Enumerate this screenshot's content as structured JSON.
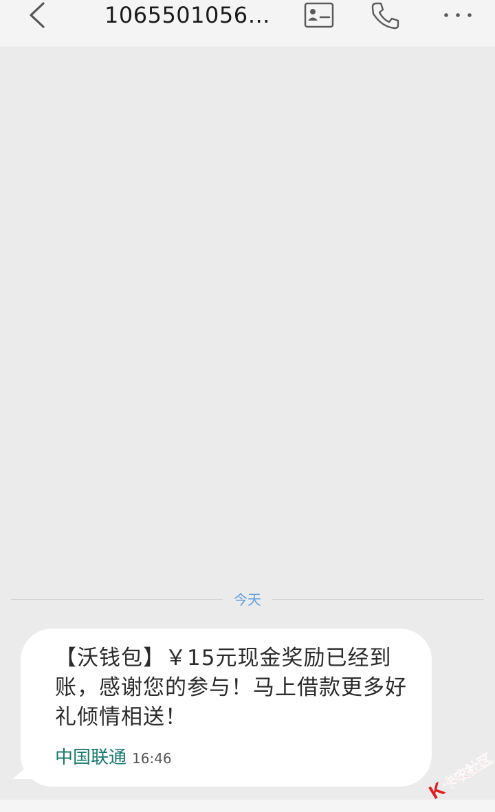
{
  "header": {
    "title": "1065501056…",
    "back_icon": "chevron-left-icon",
    "contact_icon": "contact-card-icon",
    "call_icon": "phone-icon",
    "more_icon": "more-dots-icon"
  },
  "conversation": {
    "date_label": "今天",
    "messages": [
      {
        "text": "【沃钱包】￥15元现金奖励已经到账，感谢您的参与！马上借款更多好礼倾情相送！",
        "sender": "中国联通",
        "time": "16:46"
      }
    ]
  },
  "watermark": {
    "text": "卡农社区"
  },
  "colors": {
    "background": "#ebebeb",
    "header_bg": "#f4f4f4",
    "bubble_bg": "#ffffff",
    "date_label": "#5a9fe0",
    "sender_link": "#157a6e",
    "watermark_red": "#e02020"
  }
}
